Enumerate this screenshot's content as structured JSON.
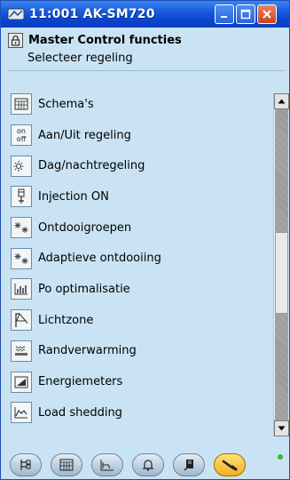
{
  "window": {
    "title": "11:001 AK-SM720"
  },
  "header": {
    "title": "Master Control functies",
    "subtitle": "Selecteer regeling"
  },
  "items": [
    {
      "label": "Schema's",
      "icon": "calendar-icon"
    },
    {
      "label": "Aan/Uit regeling",
      "icon": "on-off-icon",
      "icon_text_top": "on",
      "icon_text_bottom": "off"
    },
    {
      "label": "Dag/nachtregeling",
      "icon": "day-night-icon"
    },
    {
      "label": "Injection ON",
      "icon": "injection-icon"
    },
    {
      "label": "Ontdooigroepen",
      "icon": "defrost-groups-icon"
    },
    {
      "label": "Adaptieve ontdooiing",
      "icon": "adaptive-defrost-icon"
    },
    {
      "label": "Po optimalisatie",
      "icon": "po-optimization-icon"
    },
    {
      "label": "Lichtzone",
      "icon": "light-zone-icon"
    },
    {
      "label": "Randverwarming",
      "icon": "rail-heat-icon"
    },
    {
      "label": "Energiemeters",
      "icon": "energy-meter-icon"
    },
    {
      "label": "Load shedding",
      "icon": "load-shedding-icon"
    }
  ],
  "toolbar": {
    "buttons": [
      "network-icon",
      "grid-icon",
      "graph-icon",
      "alarm-bell-icon",
      "notes-icon",
      "wrench-icon"
    ],
    "active": "wrench-icon"
  },
  "colors": {
    "titlebar": "#0a45cf",
    "background": "#c9e3f4",
    "active_tool": "#f0b020",
    "status": "#3ab83a"
  }
}
